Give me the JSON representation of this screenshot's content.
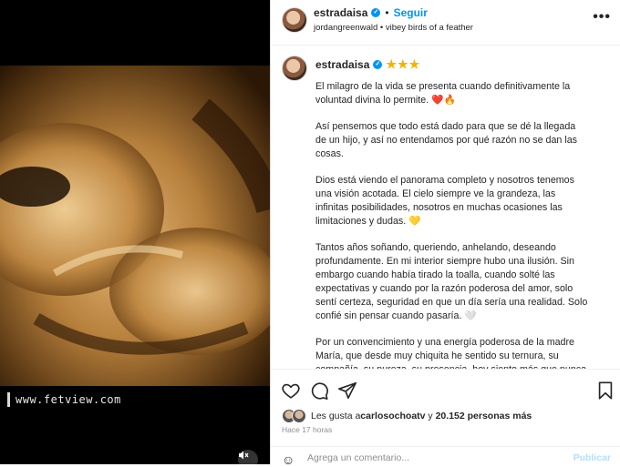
{
  "post": {
    "username": "estradaisa",
    "verified_icon": "verified-badge-icon",
    "follow_label": "Seguir",
    "separator": "•",
    "audio_artist": "jordangreenwald",
    "audio_track": "vibey birds of a feather",
    "audio_separator": "•",
    "more_icon": "more-options-icon",
    "more_glyph": "•••"
  },
  "media": {
    "watermark": "www.fetview.com",
    "mute_icon": "speaker-muted-icon"
  },
  "caption": {
    "username": "estradaisa",
    "stars": "★★★",
    "paragraphs": [
      "El milagro de la vida se presenta cuando definitivamente la voluntad divina lo permite. ❤️🔥",
      "Así pensemos que todo está dado para que se dé la llegada de un hijo, y así no entendamos por qué razón no se dan las cosas.",
      "Dios está viendo el panorama completo y nosotros tenemos una visión acotada. El cielo siempre ve la grandeza, las infinitas posibilidades, nosotros en muchas ocasiones las limitaciones y dudas. 💛",
      "Tantos años soñando, queriendo, anhelando, deseando profundamente. En mi interior siempre hubo una ilusión. Sin embargo cuando había tirado la toalla, cuando solté las expectativas y cuando por la razón poderosa del amor, solo sentí certeza, seguridad en que un día sería una realidad. Solo confié sin pensar cuando pasaría. 🤍",
      "Por un convencimiento y una energía poderosa de la madre María, que desde muy chiquita he sentido su ternura, su compañía, su pureza, su presencia, hoy siento más que nunca su luz y amor inconmensurable. 🕊"
    ]
  },
  "actions": {
    "like_icon": "heart-icon",
    "comment_icon": "comment-icon",
    "share_icon": "send-icon",
    "save_icon": "bookmark-icon"
  },
  "likes": {
    "prefix": "Les gusta a ",
    "first_user": "carlosochoatv",
    "middle": " y ",
    "count": "20.152 personas más"
  },
  "timestamp": "Hace 17 horas",
  "comment": {
    "emoji_icon": "emoji-icon",
    "placeholder": "Agrega un comentario...",
    "publish_label": "Publicar"
  },
  "colors": {
    "accent": "#0095f6",
    "muted_text": "#8e8e8e",
    "star": "#f2b400"
  }
}
